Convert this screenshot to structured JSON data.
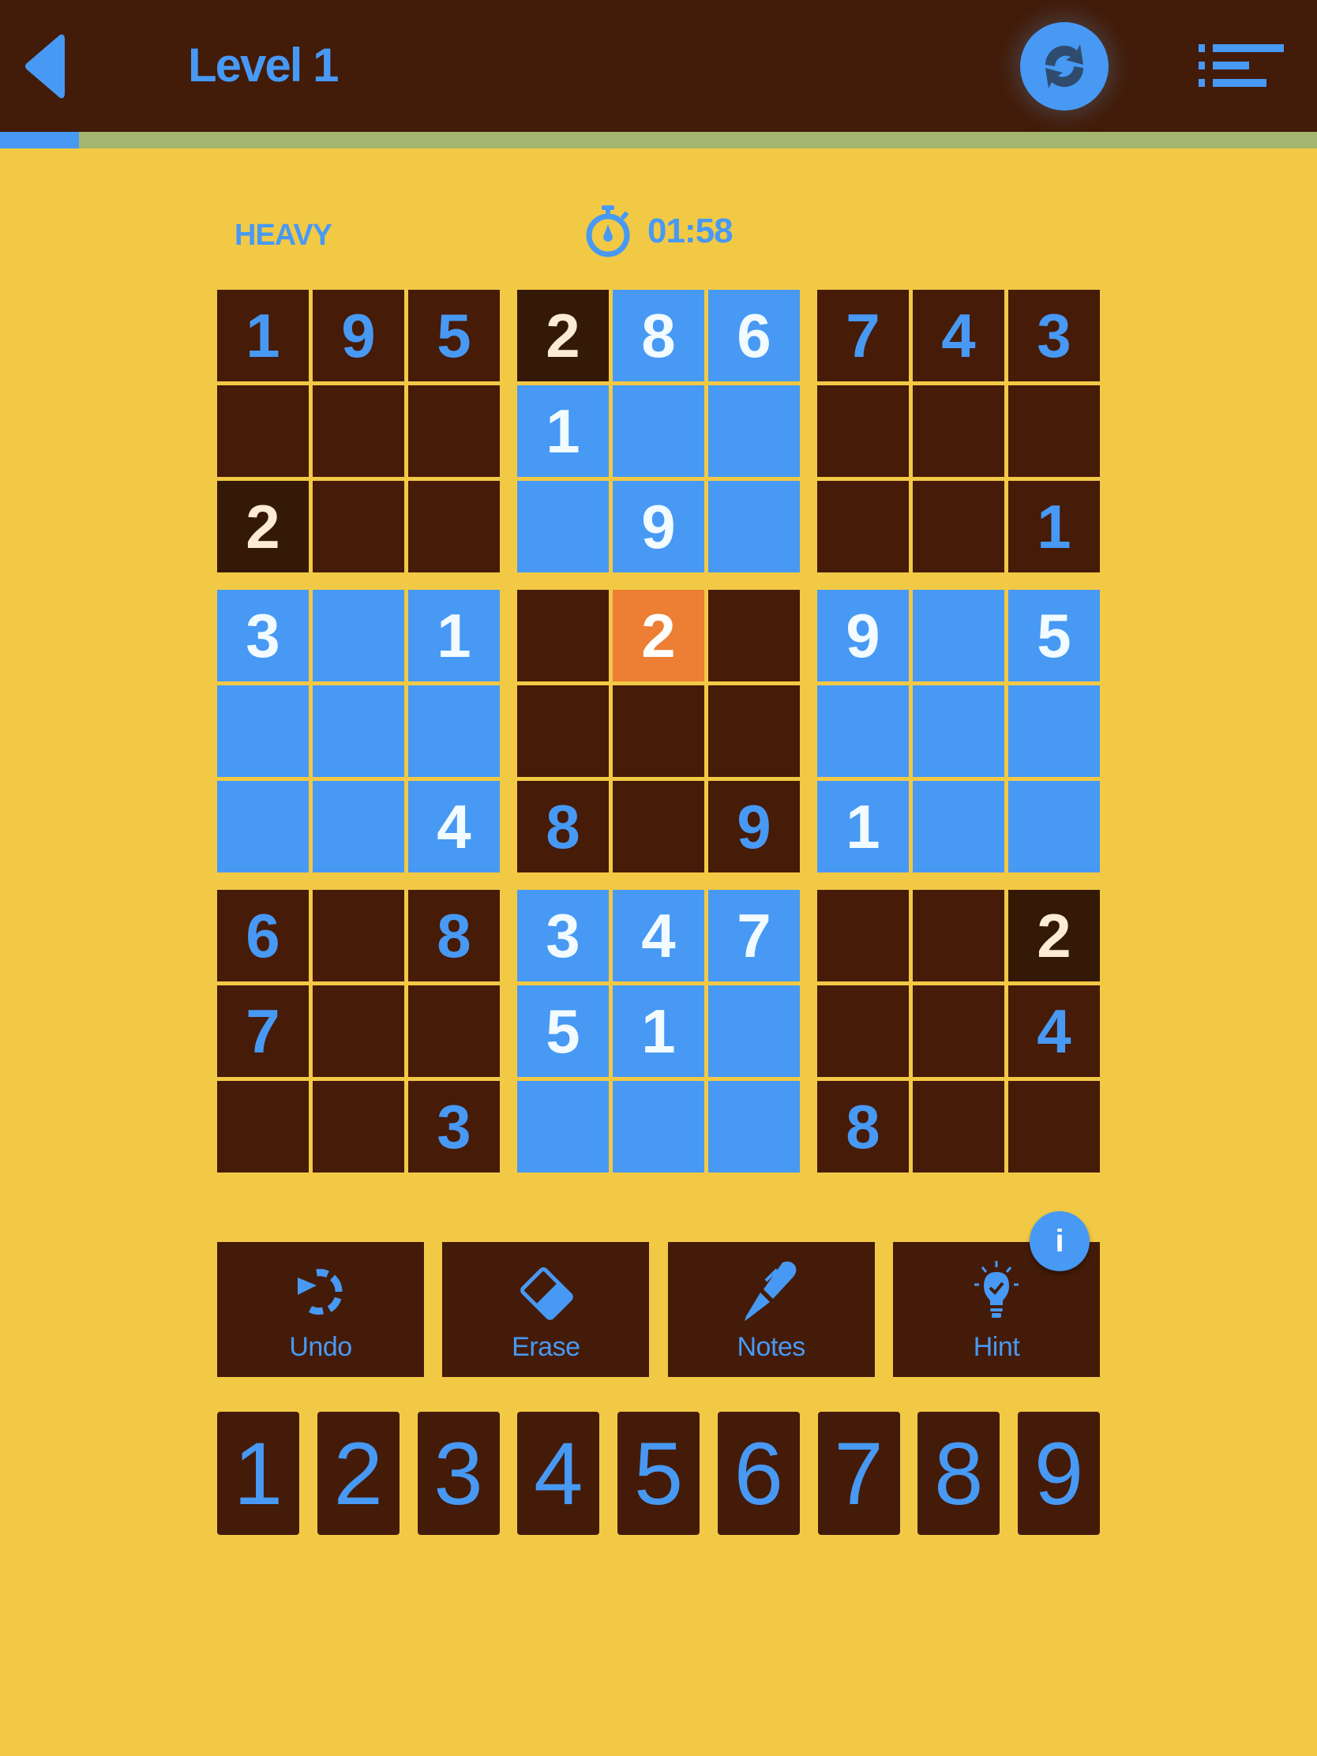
{
  "header": {
    "title": "Level 1",
    "back_icon": "chevron-left-icon",
    "restart_icon": "restart-icon",
    "menu_icon": "list-menu-icon"
  },
  "progress": {
    "fraction": 0.06
  },
  "status": {
    "difficulty": "HEAVY",
    "timer_icon": "stopwatch-icon",
    "time": "01:58"
  },
  "colors": {
    "accent": "#4799f4",
    "background": "#f2c945",
    "cell_brown": "#461b08",
    "selected": "#ec7f33"
  },
  "board": {
    "selected_digit": "2",
    "rows": [
      [
        {
          "v": "1",
          "s": "given"
        },
        {
          "v": "9",
          "s": "given"
        },
        {
          "v": "5",
          "s": "given"
        },
        {
          "v": "2",
          "s": "same"
        },
        {
          "v": "8",
          "s": "highlight"
        },
        {
          "v": "6",
          "s": "highlight"
        },
        {
          "v": "7",
          "s": "given"
        },
        {
          "v": "4",
          "s": "given"
        },
        {
          "v": "3",
          "s": "given"
        }
      ],
      [
        {
          "v": "",
          "s": "given"
        },
        {
          "v": "",
          "s": "given"
        },
        {
          "v": "",
          "s": "given"
        },
        {
          "v": "1",
          "s": "highlight"
        },
        {
          "v": "",
          "s": "highlight"
        },
        {
          "v": "",
          "s": "highlight"
        },
        {
          "v": "",
          "s": "given"
        },
        {
          "v": "",
          "s": "given"
        },
        {
          "v": "",
          "s": "given"
        }
      ],
      [
        {
          "v": "2",
          "s": "same"
        },
        {
          "v": "",
          "s": "given"
        },
        {
          "v": "",
          "s": "given"
        },
        {
          "v": "",
          "s": "highlight"
        },
        {
          "v": "9",
          "s": "highlight"
        },
        {
          "v": "",
          "s": "highlight"
        },
        {
          "v": "",
          "s": "given"
        },
        {
          "v": "",
          "s": "given"
        },
        {
          "v": "1",
          "s": "given"
        }
      ],
      [
        {
          "v": "3",
          "s": "highlight"
        },
        {
          "v": "",
          "s": "highlight"
        },
        {
          "v": "1",
          "s": "highlight"
        },
        {
          "v": "",
          "s": "given"
        },
        {
          "v": "2",
          "s": "selected"
        },
        {
          "v": "",
          "s": "given"
        },
        {
          "v": "9",
          "s": "highlight"
        },
        {
          "v": "",
          "s": "highlight"
        },
        {
          "v": "5",
          "s": "highlight"
        }
      ],
      [
        {
          "v": "",
          "s": "highlight"
        },
        {
          "v": "",
          "s": "highlight"
        },
        {
          "v": "",
          "s": "highlight"
        },
        {
          "v": "",
          "s": "given"
        },
        {
          "v": "",
          "s": "given"
        },
        {
          "v": "",
          "s": "given"
        },
        {
          "v": "",
          "s": "highlight"
        },
        {
          "v": "",
          "s": "highlight"
        },
        {
          "v": "",
          "s": "highlight"
        }
      ],
      [
        {
          "v": "",
          "s": "highlight"
        },
        {
          "v": "",
          "s": "highlight"
        },
        {
          "v": "4",
          "s": "highlight"
        },
        {
          "v": "8",
          "s": "given"
        },
        {
          "v": "",
          "s": "given"
        },
        {
          "v": "9",
          "s": "given"
        },
        {
          "v": "1",
          "s": "highlight"
        },
        {
          "v": "",
          "s": "highlight"
        },
        {
          "v": "",
          "s": "highlight"
        }
      ],
      [
        {
          "v": "6",
          "s": "given"
        },
        {
          "v": "",
          "s": "given"
        },
        {
          "v": "8",
          "s": "given"
        },
        {
          "v": "3",
          "s": "highlight"
        },
        {
          "v": "4",
          "s": "highlight"
        },
        {
          "v": "7",
          "s": "highlight"
        },
        {
          "v": "",
          "s": "given"
        },
        {
          "v": "",
          "s": "given"
        },
        {
          "v": "2",
          "s": "same"
        }
      ],
      [
        {
          "v": "7",
          "s": "given"
        },
        {
          "v": "",
          "s": "given"
        },
        {
          "v": "",
          "s": "given"
        },
        {
          "v": "5",
          "s": "highlight"
        },
        {
          "v": "1",
          "s": "highlight"
        },
        {
          "v": "",
          "s": "highlight"
        },
        {
          "v": "",
          "s": "given"
        },
        {
          "v": "",
          "s": "given"
        },
        {
          "v": "4",
          "s": "given"
        }
      ],
      [
        {
          "v": "",
          "s": "given"
        },
        {
          "v": "",
          "s": "given"
        },
        {
          "v": "3",
          "s": "given"
        },
        {
          "v": "",
          "s": "highlight"
        },
        {
          "v": "",
          "s": "highlight"
        },
        {
          "v": "",
          "s": "highlight"
        },
        {
          "v": "8",
          "s": "given"
        },
        {
          "v": "",
          "s": "given"
        },
        {
          "v": "",
          "s": "given"
        }
      ]
    ]
  },
  "actions": [
    {
      "label": "Undo",
      "icon": "undo-icon"
    },
    {
      "label": "Erase",
      "icon": "eraser-icon"
    },
    {
      "label": "Notes",
      "icon": "pen-icon"
    },
    {
      "label": "Hint",
      "icon": "lightbulb-icon"
    }
  ],
  "info_badge": {
    "label": "i",
    "icon": "info-icon"
  },
  "numpad": [
    "1",
    "2",
    "3",
    "4",
    "5",
    "6",
    "7",
    "8",
    "9"
  ]
}
